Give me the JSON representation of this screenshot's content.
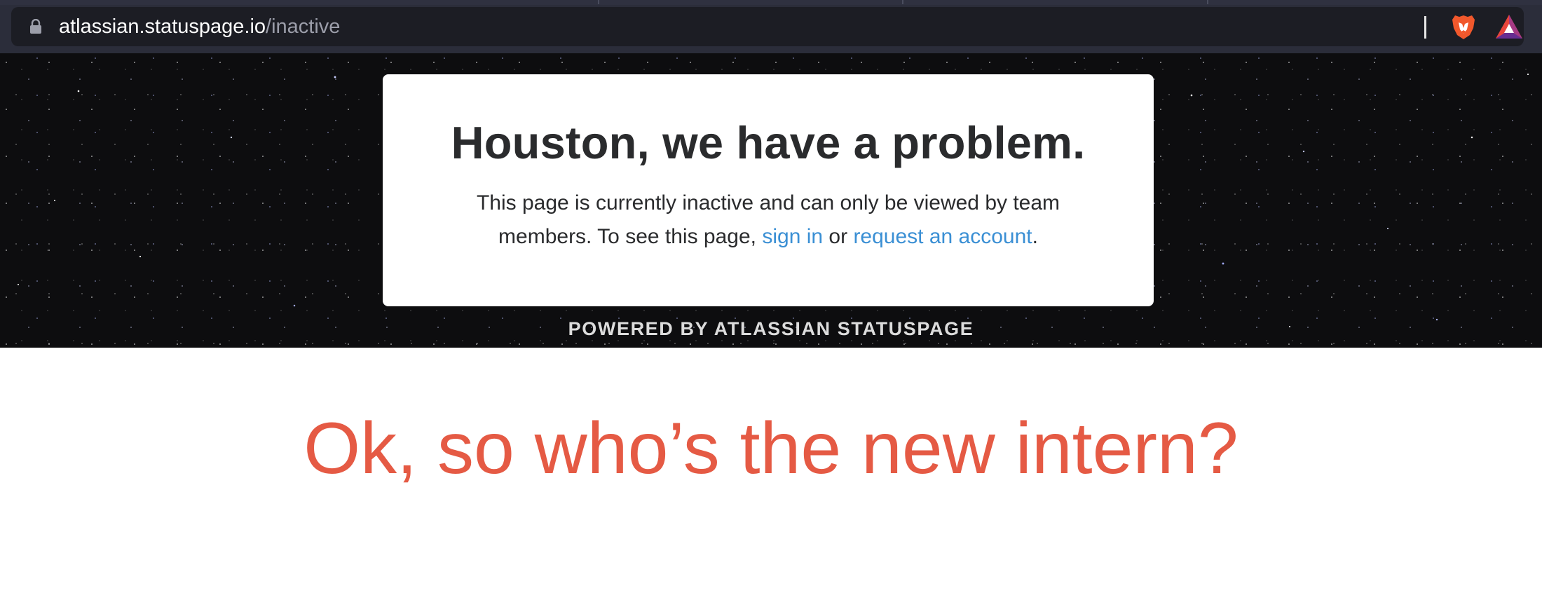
{
  "browser": {
    "url_host": "atlassian.statuspage.io",
    "url_path": "/inactive",
    "icons": [
      "lock-icon",
      "brave-lion-icon",
      "bat-rewards-icon"
    ]
  },
  "page": {
    "heading": "Houston, we have a problem.",
    "body_prefix": "This page is currently inactive and can only be viewed by team members. To see this page,",
    "sign_in_link": "sign in",
    "connector": "or",
    "request_link": "request an account",
    "body_suffix": ".",
    "powered_by": "POWERED BY ATLASSIAN STATUSPAGE",
    "link_color": "#3a8fd4"
  },
  "caption": {
    "text": "Ok, so who’s the new intern?",
    "color": "#e55a44"
  }
}
